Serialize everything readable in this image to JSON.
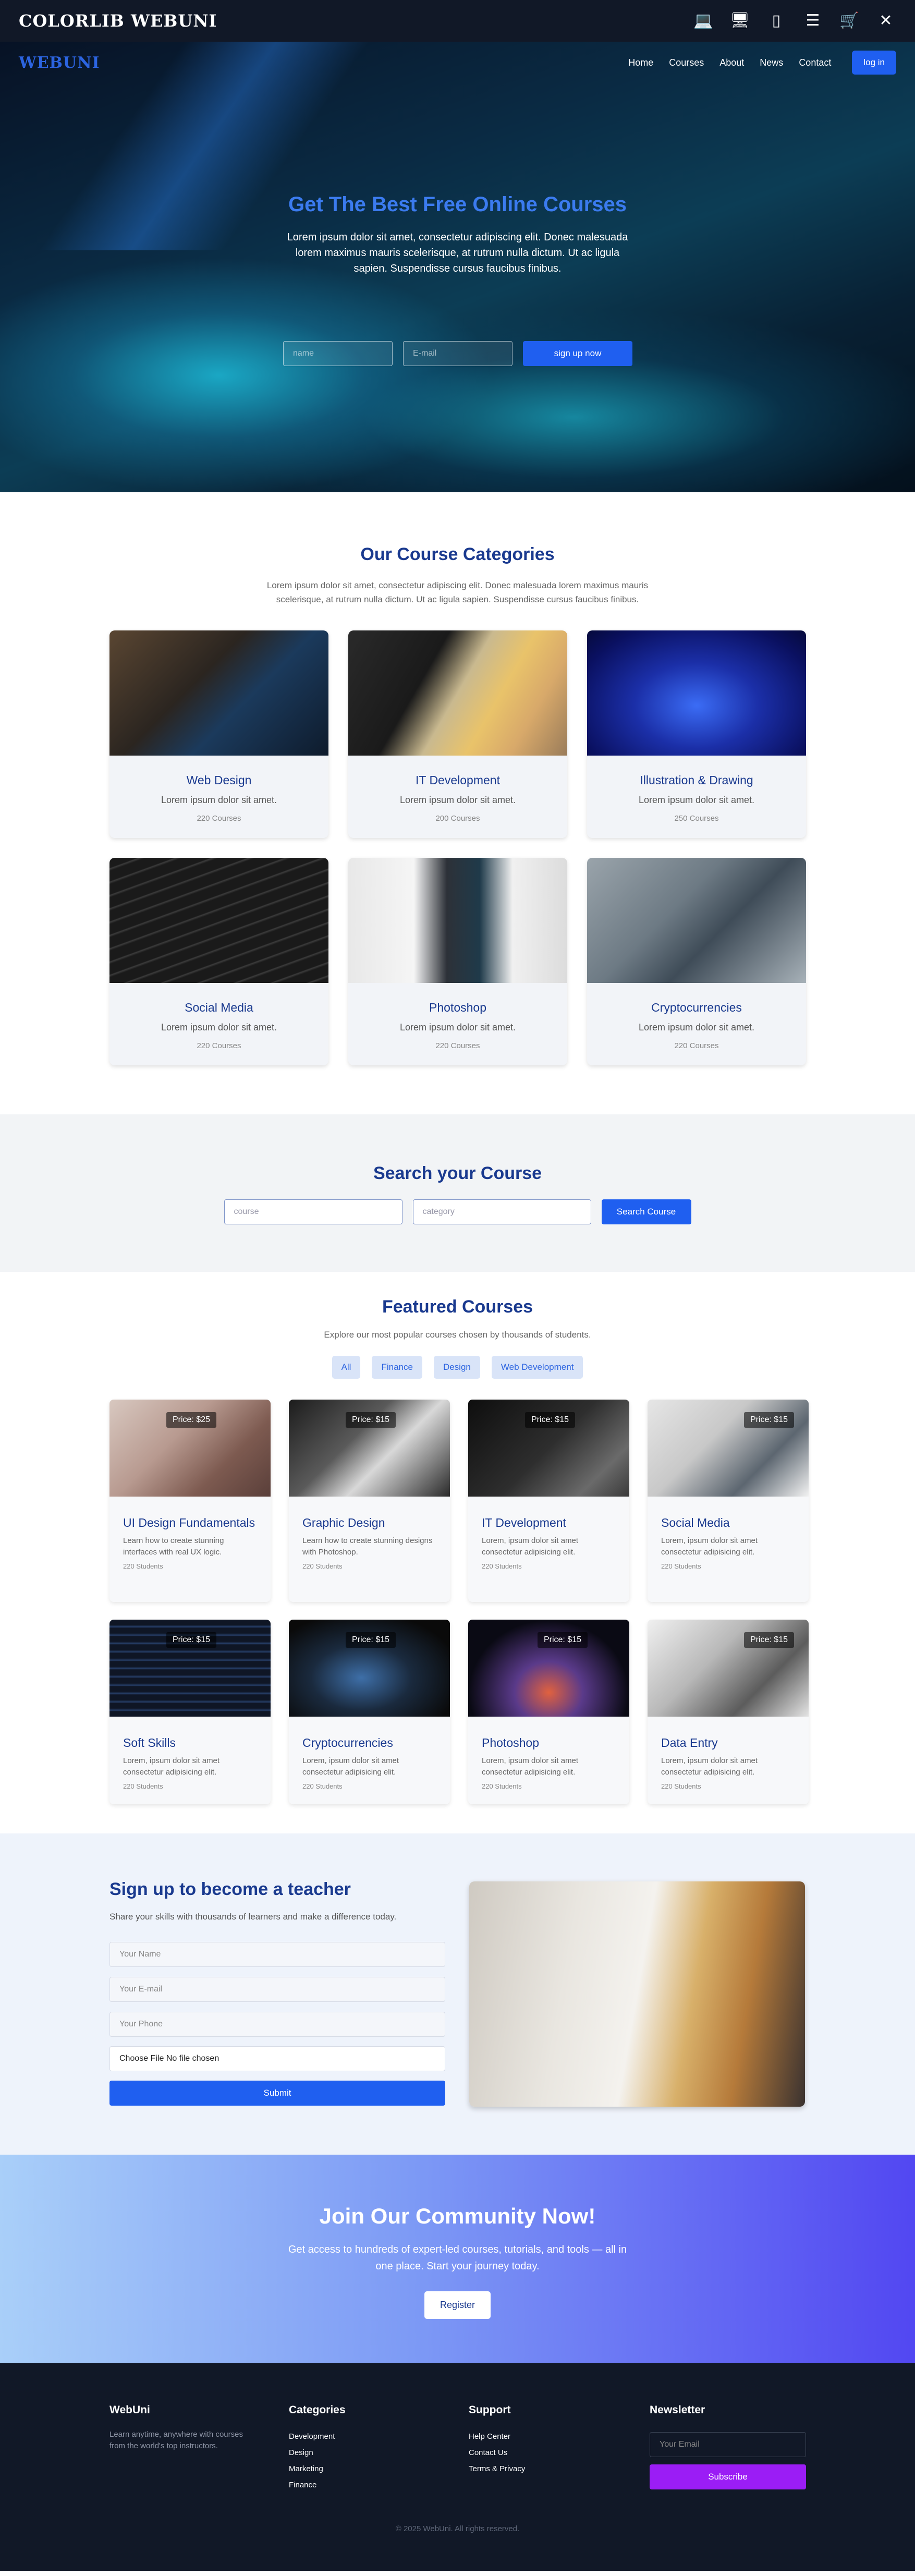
{
  "topbar": {
    "brand": "COLORLIB WEBUNI",
    "icons": [
      "laptop-icon",
      "desktop-icon",
      "mobile-icon",
      "list-icon",
      "cart-icon",
      "close-icon"
    ]
  },
  "nav": {
    "logo": "WEBUNI",
    "links": [
      "Home",
      "Courses",
      "About",
      "News",
      "Contact"
    ],
    "login": "log in"
  },
  "hero": {
    "title": "Get The Best Free Online Courses",
    "text": "Lorem ipsum dolor sit amet, consectetur adipiscing elit. Donec malesuada lorem maximus mauris scelerisque, at rutrum nulla dictum. Ut ac ligula sapien. Suspendisse cursus faucibus finibus.",
    "name_placeholder": "name",
    "email_placeholder": "E-mail",
    "cta": "sign up now"
  },
  "categories": {
    "title": "Our Course Categories",
    "lead": "Lorem ipsum dolor sit amet, consectetur adipiscing elit. Donec malesuada lorem maximus mauris scelerisque, at rutrum nulla dictum. Ut ac ligula sapien. Suspendisse cursus faucibus finibus.",
    "items": [
      {
        "title": "Web Design",
        "desc": "Lorem ipsum dolor sit amet.",
        "count": "220 Courses"
      },
      {
        "title": "IT Development",
        "desc": "Lorem ipsum dolor sit amet.",
        "count": "200 Courses"
      },
      {
        "title": "Illustration & Drawing",
        "desc": "Lorem ipsum dolor sit amet.",
        "count": "250 Courses"
      },
      {
        "title": "Social Media",
        "desc": "Lorem ipsum dolor sit amet.",
        "count": "220 Courses"
      },
      {
        "title": "Photoshop",
        "desc": "Lorem ipsum dolor sit amet.",
        "count": "220 Courses"
      },
      {
        "title": "Cryptocurrencies",
        "desc": "Lorem ipsum dolor sit amet.",
        "count": "220 Courses"
      }
    ]
  },
  "search": {
    "title": "Search your Course",
    "course_placeholder": "course",
    "category_placeholder": "category",
    "button": "Search Course"
  },
  "featured": {
    "title": "Featured Courses",
    "lead": "Explore our most popular courses chosen by thousands of students.",
    "filters": [
      "All",
      "Finance",
      "Design",
      "Web Development"
    ],
    "items": [
      {
        "price": "Price: $25",
        "title": "UI Design Fundamentals",
        "desc": "Learn how to create stunning interfaces with real UX logic.",
        "students": "220 Students"
      },
      {
        "price": "Price: $15",
        "title": "Graphic Design",
        "desc": "Learn how to create stunning designs with Photoshop.",
        "students": "220 Students"
      },
      {
        "price": "Price: $15",
        "title": "IT Development",
        "desc": "Lorem, ipsum dolor sit amet consectetur adipisicing elit.",
        "students": "220 Students"
      },
      {
        "price": "Price: $15",
        "title": "Social Media",
        "desc": "Lorem, ipsum dolor sit amet consectetur adipisicing elit.",
        "students": "220 Students"
      },
      {
        "price": "Price: $15",
        "title": "Soft Skills",
        "desc": "Lorem, ipsum dolor sit amet consectetur adipisicing elit.",
        "students": "220 Students"
      },
      {
        "price": "Price: $15",
        "title": "Cryptocurrencies",
        "desc": "Lorem, ipsum dolor sit amet consectetur adipisicing elit.",
        "students": "220 Students"
      },
      {
        "price": "Price: $15",
        "title": "Photoshop",
        "desc": "Lorem, ipsum dolor sit amet consectetur adipisicing elit.",
        "students": "220 Students"
      },
      {
        "price": "Price: $15",
        "title": "Data Entry",
        "desc": "Lorem, ipsum dolor sit amet consectetur adipisicing elit.",
        "students": "220 Students"
      }
    ]
  },
  "teacher": {
    "title": "Sign up to become a teacher",
    "lead": "Share your skills with thousands of learners and make a difference today.",
    "name_placeholder": "Your Name",
    "email_placeholder": "Your E-mail",
    "phone_placeholder": "Your Phone",
    "file_text": "Choose File No file chosen",
    "submit": "Submit"
  },
  "join": {
    "title": "Join Our Community Now!",
    "text": "Get access to hundreds of expert-led courses, tutorials, and tools — all in one place. Start your journey today.",
    "button": "Register"
  },
  "footer": {
    "brand": "WebUni",
    "tagline": "Learn anytime, anywhere with courses from the world's top instructors.",
    "categories_title": "Categories",
    "categories": [
      "Development",
      "Design",
      "Marketing",
      "Finance"
    ],
    "support_title": "Support",
    "support": [
      "Help Center",
      "Contact Us",
      "Terms & Privacy"
    ],
    "newsletter_title": "Newsletter",
    "email_placeholder": "Your Email",
    "subscribe": "Subscribe",
    "copyright": "© 2025 WebUni. All rights reserved."
  }
}
